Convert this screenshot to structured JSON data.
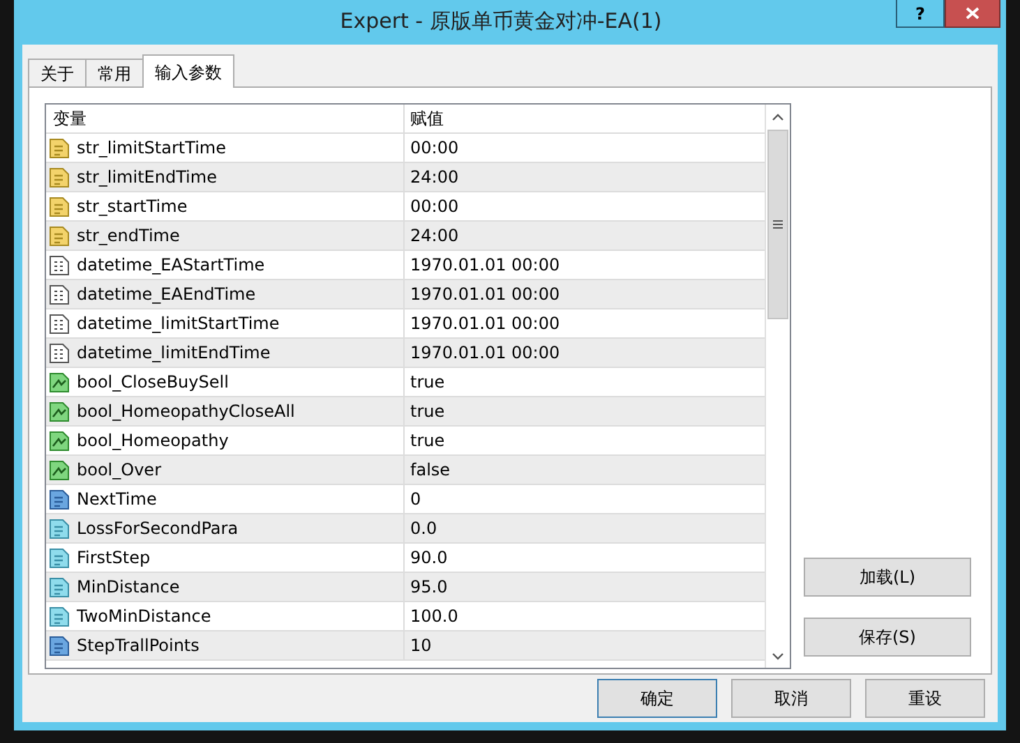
{
  "window": {
    "title": "Expert - 原版单币黄金对冲-EA(1)",
    "help": "?"
  },
  "tabs": [
    {
      "label": "关于",
      "selected": false
    },
    {
      "label": "常用",
      "selected": false
    },
    {
      "label": "输入参数",
      "selected": true
    }
  ],
  "table": {
    "columns": [
      "变量",
      "赋值"
    ],
    "rows": [
      {
        "kind": "string",
        "name": "str_limitStartTime",
        "value": "00:00"
      },
      {
        "kind": "string",
        "name": "str_limitEndTime",
        "value": "24:00"
      },
      {
        "kind": "string",
        "name": "str_startTime",
        "value": "00:00"
      },
      {
        "kind": "string",
        "name": "str_endTime",
        "value": "24:00"
      },
      {
        "kind": "datetime",
        "name": "datetime_EAStartTime",
        "value": "1970.01.01 00:00"
      },
      {
        "kind": "datetime",
        "name": "datetime_EAEndTime",
        "value": "1970.01.01 00:00"
      },
      {
        "kind": "datetime",
        "name": "datetime_limitStartTime",
        "value": "1970.01.01 00:00"
      },
      {
        "kind": "datetime",
        "name": "datetime_limitEndTime",
        "value": "1970.01.01 00:00"
      },
      {
        "kind": "bool",
        "name": "bool_CloseBuySell",
        "value": "true"
      },
      {
        "kind": "bool",
        "name": "bool_HomeopathyCloseAll",
        "value": "true"
      },
      {
        "kind": "bool",
        "name": "bool_Homeopathy",
        "value": "true"
      },
      {
        "kind": "bool",
        "name": "bool_Over",
        "value": "false"
      },
      {
        "kind": "int",
        "name": "NextTime",
        "value": "0"
      },
      {
        "kind": "double",
        "name": "LossForSecondPara",
        "value": "0.0"
      },
      {
        "kind": "double",
        "name": "FirstStep",
        "value": "90.0"
      },
      {
        "kind": "double",
        "name": "MinDistance",
        "value": "95.0"
      },
      {
        "kind": "double",
        "name": "TwoMinDistance",
        "value": "100.0"
      },
      {
        "kind": "int",
        "name": "StepTrallPoints",
        "value": "10"
      }
    ]
  },
  "side_buttons": [
    "加载(L)",
    "保存(S)"
  ],
  "buttons": [
    {
      "label": "确定",
      "default": true
    },
    {
      "label": "取消",
      "default": false
    },
    {
      "label": "重设",
      "default": false
    }
  ]
}
